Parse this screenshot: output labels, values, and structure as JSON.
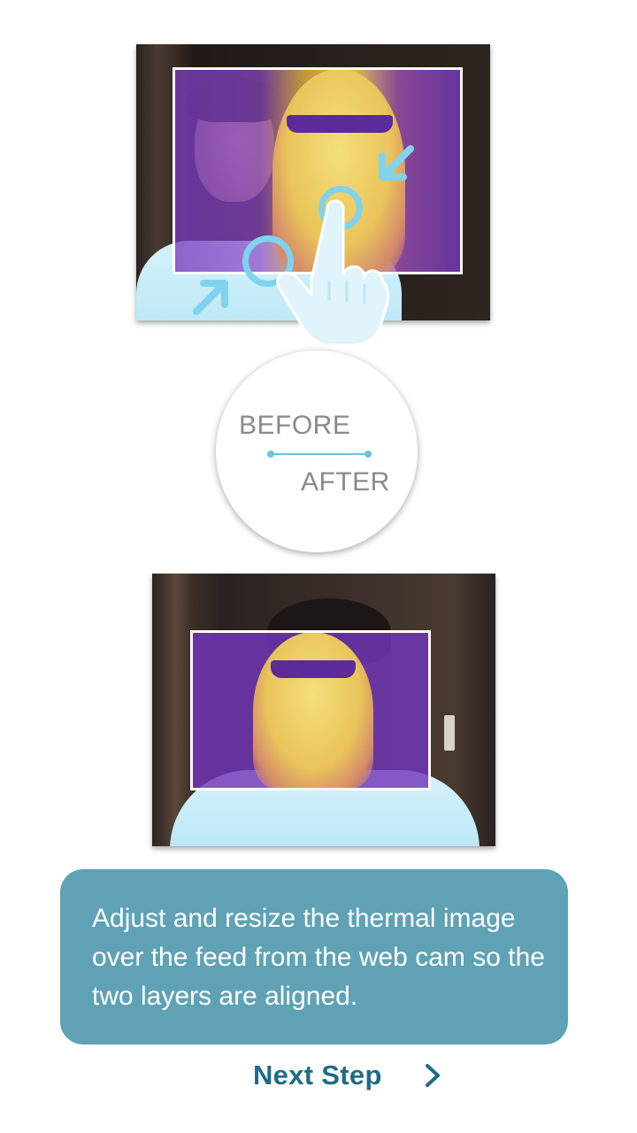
{
  "comparison": {
    "before_label": "BEFORE",
    "after_label": "AFTER"
  },
  "instruction": {
    "text": "Adjust and resize the thermal image over the feed from the web cam so the two layers are aligned."
  },
  "navigation": {
    "next_label": "Next Step",
    "next_icon": "chevron-right-icon"
  },
  "colors": {
    "accent": "#7fd3ee",
    "card": "#5fa2b5",
    "next_text": "#1e6b85",
    "label_gray": "#8a8a8a"
  },
  "icons": {
    "pinch_gesture": "pinch-zoom-gesture-icon",
    "hand": "pointing-hand-icon",
    "arrow_in": "arrow-inward-icon"
  }
}
